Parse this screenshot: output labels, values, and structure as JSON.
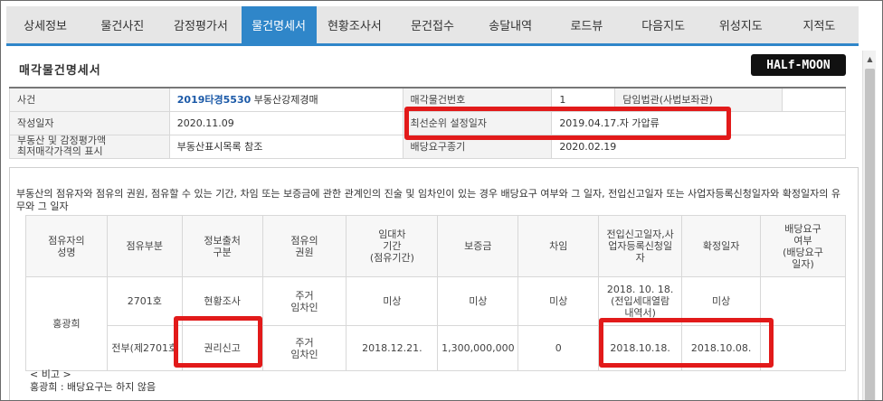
{
  "tabs": [
    {
      "label": "상세정보",
      "active": false
    },
    {
      "label": "물건사진",
      "active": false
    },
    {
      "label": "감정평가서",
      "active": false
    },
    {
      "label": "물건명세서",
      "active": true
    },
    {
      "label": "현황조사서",
      "active": false
    },
    {
      "label": "문건접수",
      "active": false
    },
    {
      "label": "송달내역",
      "active": false
    },
    {
      "label": "로드뷰",
      "active": false
    },
    {
      "label": "다음지도",
      "active": false
    },
    {
      "label": "위성지도",
      "active": false
    },
    {
      "label": "지적도",
      "active": false
    }
  ],
  "section_title": "매각물건명세서",
  "logo_text": "HALf-MOON",
  "info": {
    "case_label": "사건",
    "case_number": "2019타경5530",
    "case_type": "부동산강제경매",
    "item_no_label": "매각물건번호",
    "item_no": "1",
    "judge": "담임법관(사법보좌관)",
    "created_label": "작성일자",
    "created_date": "2020.11.09",
    "priority_label": "최선순위 설정일자",
    "priority_value": "2019.04.17.자 가압류",
    "property_label_1": "부동산 및 감정평가액",
    "property_label_2": "최저매각가격의 표시",
    "property_value": "부동산표시목록 참조",
    "dividend_label": "배당요구종기",
    "dividend_date": "2020.02.19"
  },
  "occupant": {
    "description": "부동산의 점유자와 점유의 권원, 점유할 수 있는 기간, 차임 또는 보증금에 관한 관계인의 진술 및 임차인이 있는 경우 배당요구 여부와 그 일자, 전입신고일자 또는 사업자등록신청일자와 확정일자의 유무와 그 일자",
    "headers": [
      [
        "점유자의",
        "성명"
      ],
      [
        "점유부분"
      ],
      [
        "정보출처",
        "구분"
      ],
      [
        "점유의",
        "권원"
      ],
      [
        "임대차",
        "기간",
        "(점유기간)"
      ],
      [
        "보증금"
      ],
      [
        "차임"
      ],
      [
        "전입신고일자,사",
        "업자등록신청일",
        "자"
      ],
      [
        "확정일자"
      ],
      [
        "배당요구",
        "여부",
        "(배당요구",
        "일자)"
      ]
    ],
    "name": "홍광희",
    "rows": [
      {
        "part": "2701호",
        "source": "현황조사",
        "right": [
          "주거",
          "임차인"
        ],
        "period": "미상",
        "deposit": "미상",
        "rent": "미상",
        "move_in": [
          "2018. 10. 18.",
          "(전입세대열람",
          "내역서)"
        ],
        "fixed_date": "미상",
        "dividend": ""
      },
      {
        "part": "전부(제2701호",
        "source": "권리신고",
        "right": [
          "주거",
          "임차인"
        ],
        "period": "2018.12.21.",
        "deposit": "1,300,000,000",
        "rent": "0",
        "move_in": [
          "2018.10.18."
        ],
        "fixed_date": "2018.10.08.",
        "dividend": ""
      }
    ],
    "note_label": "< 비고 >",
    "note_text": "홍광희 : 배당요구는 하지 않음"
  },
  "annotation_color": "#e21a1a",
  "accent_color": "#2f86c9"
}
